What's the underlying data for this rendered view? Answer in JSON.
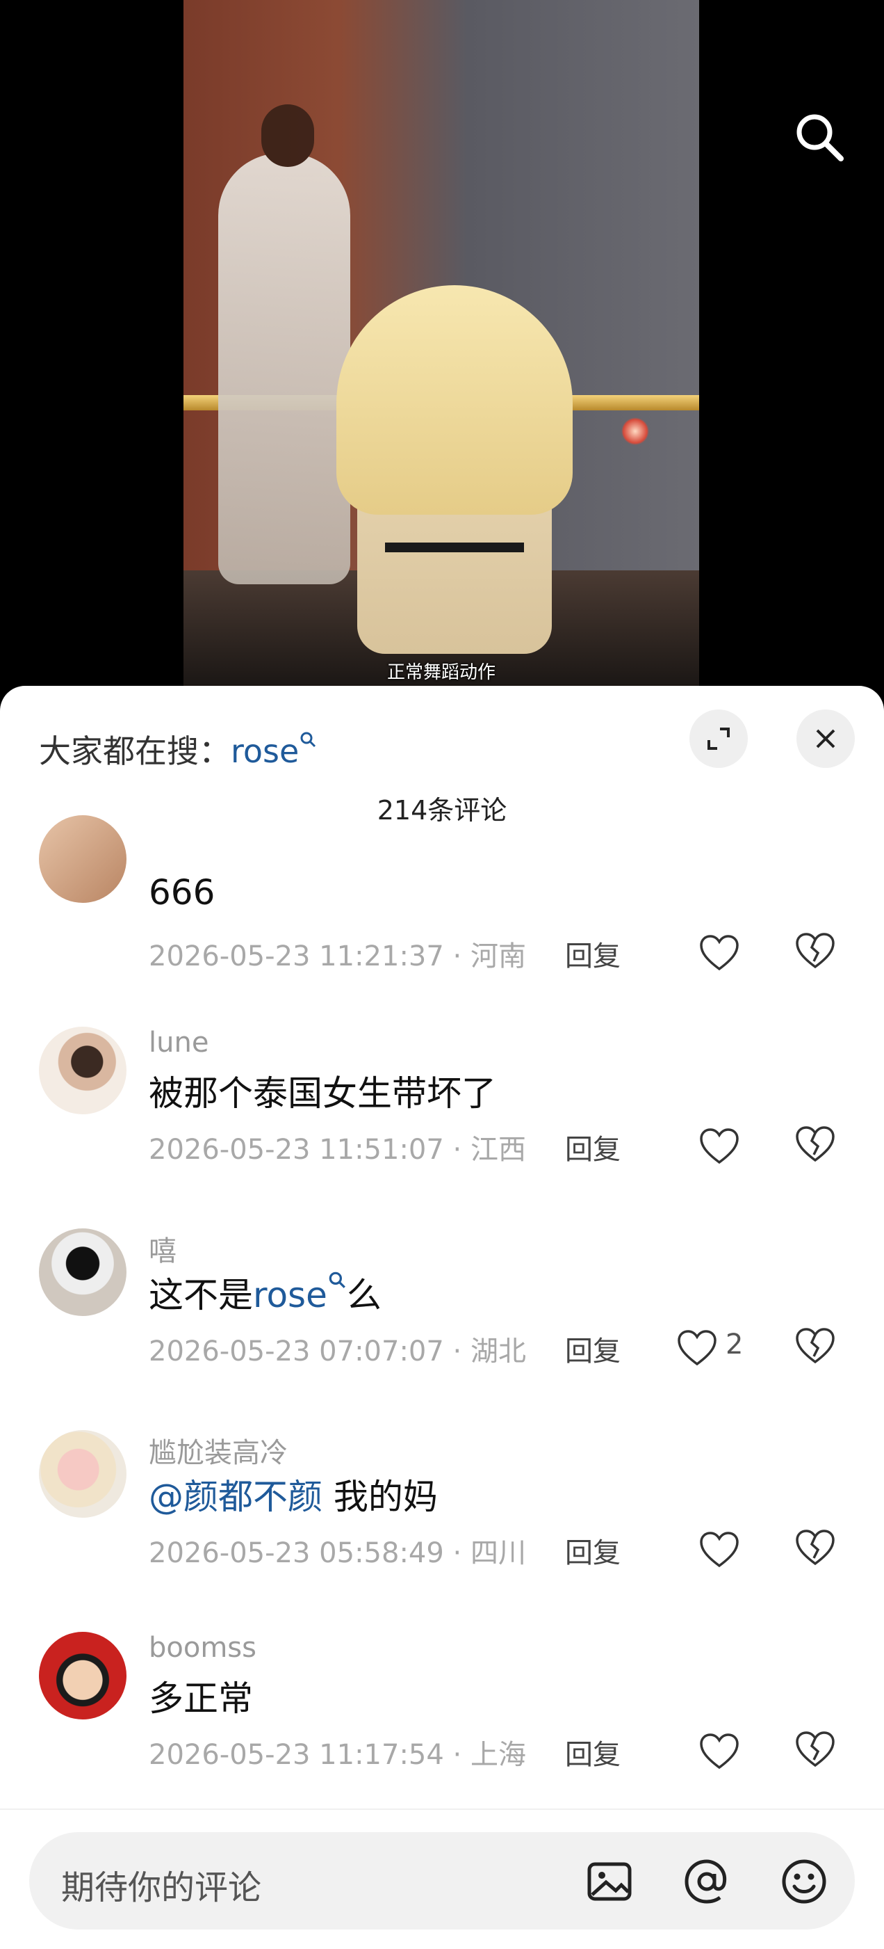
{
  "video": {
    "subtitle": "正常舞蹈动作"
  },
  "sheet": {
    "hot_search_label": "大家都在搜：",
    "hot_search_term": "rose",
    "comment_count": "214条评论"
  },
  "comments": [
    {
      "username": "",
      "text": "666",
      "timestamp": "2026-05-23 11:21:37 · 河南",
      "reply_label": "回复",
      "likes": ""
    },
    {
      "username": "lune",
      "text": "被那个泰国女生带坏了",
      "timestamp": "2026-05-23 11:51:07 · 江西",
      "reply_label": "回复",
      "likes": ""
    },
    {
      "username": "嘻",
      "text_prefix": "这不是",
      "text_link": "rose",
      "text_suffix": "么",
      "timestamp": "2026-05-23 07:07:07 · 湖北",
      "reply_label": "回复",
      "likes": "2"
    },
    {
      "username": "尴尬装高冷",
      "mention": "@颜都不颜",
      "text": " 我的妈",
      "timestamp": "2026-05-23 05:58:49 · 四川",
      "reply_label": "回复",
      "likes": ""
    },
    {
      "username": "boomss",
      "text": "多正常",
      "timestamp": "2026-05-23 11:17:54 · 上海",
      "reply_label": "回复",
      "likes": ""
    }
  ],
  "input": {
    "placeholder": "期待你的评论"
  },
  "icons": {
    "search": "search-icon",
    "expand": "expand-icon",
    "close": "close-icon",
    "image": "image-icon",
    "at": "at-icon",
    "emoji": "emoji-icon",
    "like": "heart-icon",
    "dislike": "broken-heart-icon",
    "hot_search": "search-small-icon"
  },
  "colors": {
    "link": "#1f5a9a",
    "meta": "#a8a8a8",
    "sheet_bg": "#ffffff"
  }
}
